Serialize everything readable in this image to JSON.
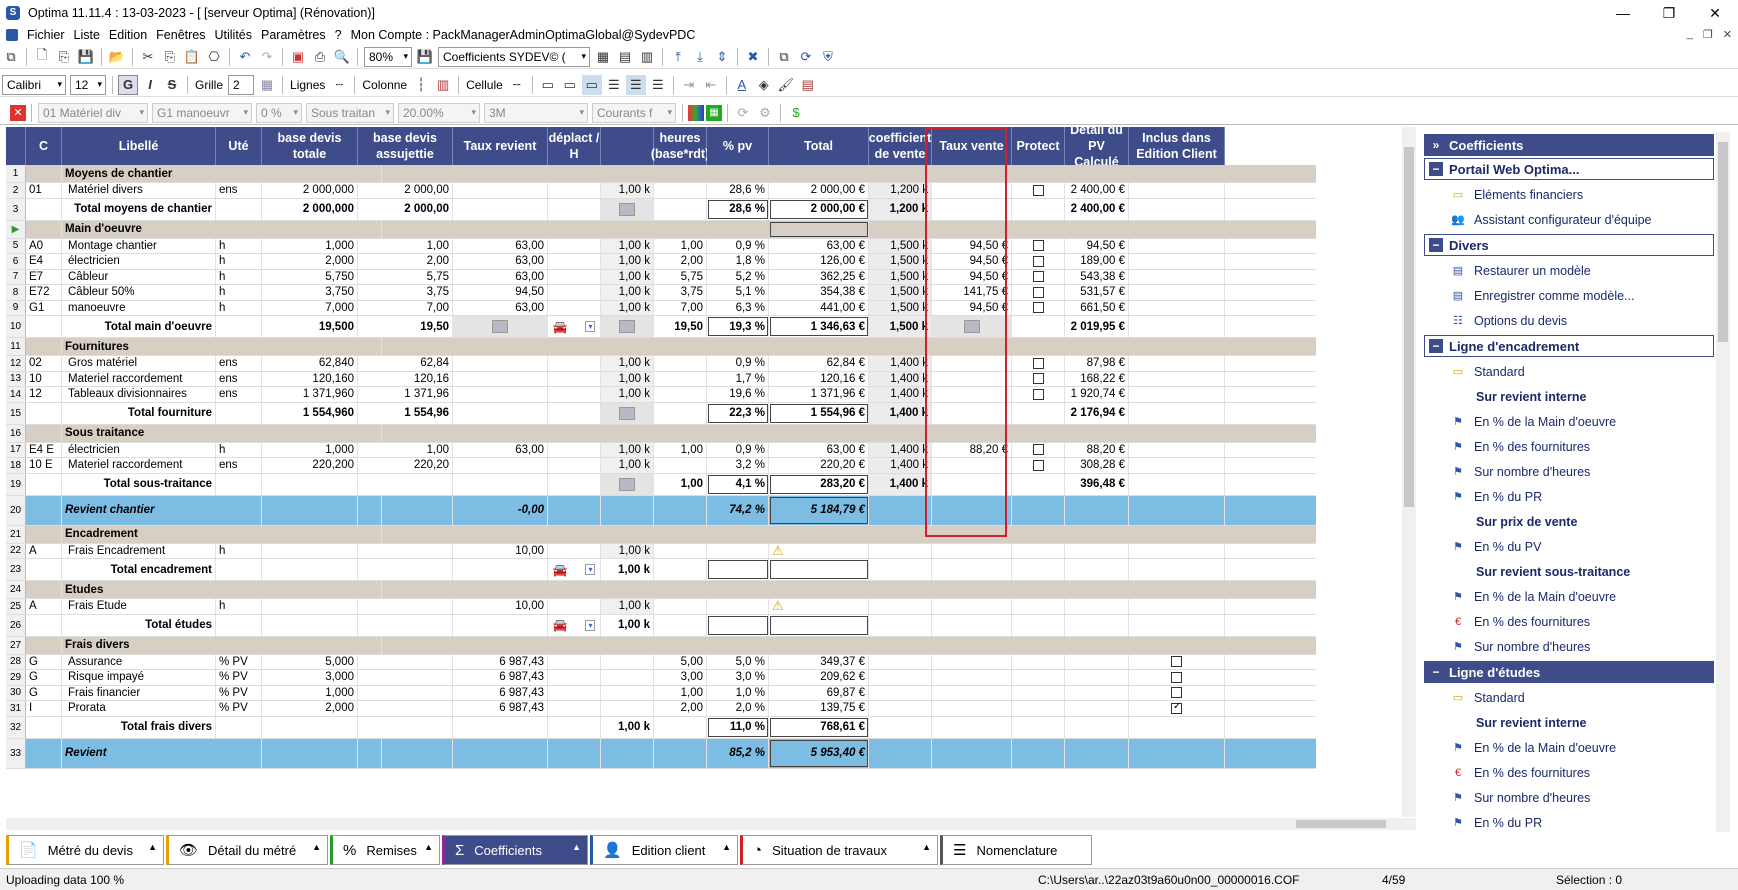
{
  "window": {
    "title": "Optima 11.11.4 : 13-03-2023 - [ [serveur Optima] (Rénovation)]"
  },
  "menu": [
    "Fichier",
    "Liste",
    "Edition",
    "Fenêtres",
    "Utilités",
    "Paramètres",
    "?",
    "Mon Compte : PackManagerAdminOptimaGlobal@SydevPDC"
  ],
  "toolbar1": {
    "zoom": "80%",
    "view": "Coefficients  SYDEV© ("
  },
  "toolbar2": {
    "font": "Calibri",
    "size": "12",
    "bold": "G",
    "italic": "I",
    "strike": "S",
    "grille": "Grille",
    "grille_val": "2",
    "lignes": "Lignes",
    "colonne": "Colonne",
    "cellule": "Cellule"
  },
  "toolbar3": {
    "f1": "01  Matériel div",
    "f2": "G1  manoeuvr",
    "f3": "0 %",
    "f4": "Sous traitan",
    "f5": "20.00%",
    "f6": "3M",
    "f7": "Courants f"
  },
  "headers": [
    "C",
    "Libellé",
    "Uté",
    "base devis totale",
    "base devis assujettie",
    "Taux revient",
    "déplact / H",
    "",
    "heures (base*rdt)",
    "% pv",
    "Total",
    "coefficient de vente",
    "Taux vente",
    "Protect",
    "Détail du PV Calculé",
    "Inclus dans Edition Client"
  ],
  "rows": [
    {
      "n": "1",
      "t": "sec",
      "lib": "Moyens de chantier"
    },
    {
      "n": "2",
      "c": "01",
      "lib": "Matériel divers",
      "ute": "ens",
      "bdt": "2 000,000",
      "bda": "2 000,00",
      "k": "1,00 k",
      "ppv": "28,6 %",
      "tot": "2 000,00 €",
      "coef": "1,200 k",
      "prot": "chk",
      "pv": "2 400,00 €"
    },
    {
      "n": "3",
      "t": "tot",
      "lib": "Total moyens de chantier",
      "bdt": "2 000,000",
      "bda": "2 000,00",
      "kicon": "1",
      "ppv": "28,6 %",
      "tot": "2 000,00 €",
      "coef": "1,200 k",
      "pv": "2 400,00 €"
    },
    {
      "n": "4",
      "t": "sec",
      "lib": "Main d'oeuvre",
      "cur": "1"
    },
    {
      "n": "5",
      "c": "A0",
      "lib": "Montage chantier",
      "ute": "h",
      "bdt": "1,000",
      "bda": "1,00",
      "tr": "63,00",
      "k": "1,00 k",
      "h": "1,00",
      "ppv": "0,9 %",
      "tot": "63,00 €",
      "coef": "1,500 k",
      "tv": "94,50 €",
      "prot": "chk",
      "pv": "94,50 €"
    },
    {
      "n": "6",
      "c": "E4",
      "lib": "électricien",
      "ute": "h",
      "bdt": "2,000",
      "bda": "2,00",
      "tr": "63,00",
      "k": "1,00 k",
      "h": "2,00",
      "ppv": "1,8 %",
      "tot": "126,00 €",
      "coef": "1,500 k",
      "tv": "94,50 €",
      "prot": "chk",
      "pv": "189,00 €"
    },
    {
      "n": "7",
      "c": "E7",
      "lib": "Câbleur",
      "ute": "h",
      "bdt": "5,750",
      "bda": "5,75",
      "tr": "63,00",
      "k": "1,00 k",
      "h": "5,75",
      "ppv": "5,2 %",
      "tot": "362,25 €",
      "coef": "1,500 k",
      "tv": "94,50 €",
      "prot": "chk",
      "pv": "543,38 €"
    },
    {
      "n": "8",
      "c": "E72",
      "lib": "Câbleur 50%",
      "ute": "h",
      "bdt": "3,750",
      "bda": "3,75",
      "tr": "94,50",
      "k": "1,00 k",
      "h": "3,75",
      "ppv": "5,1 %",
      "tot": "354,38 €",
      "coef": "1,500 k",
      "tv": "141,75 €",
      "prot": "chk",
      "pv": "531,57 €"
    },
    {
      "n": "9",
      "c": "G1",
      "lib": "manoeuvre",
      "ute": "h",
      "bdt": "7,000",
      "bda": "7,00",
      "tr": "63,00",
      "k": "1,00 k",
      "h": "7,00",
      "ppv": "6,3 %",
      "tot": "441,00 €",
      "coef": "1,500 k",
      "tv": "94,50 €",
      "prot": "chk",
      "pv": "661,50 €"
    },
    {
      "n": "10",
      "t": "tot",
      "lib": "Total main d'oeuvre",
      "bdt": "19,500",
      "bda": "19,50",
      "tricon": "1",
      "car": "1",
      "kicon": "1",
      "h": "19,50",
      "ppv": "19,3 %",
      "tot": "1 346,63 €",
      "coef": "1,500 k",
      "tvicon": "1",
      "pv": "2 019,95 €"
    },
    {
      "n": "11",
      "t": "sec",
      "lib": "Fournitures"
    },
    {
      "n": "12",
      "c": "02",
      "lib": "Gros matériel",
      "ute": "ens",
      "bdt": "62,840",
      "bda": "62,84",
      "k": "1,00 k",
      "ppv": "0,9 %",
      "tot": "62,84 €",
      "coef": "1,400 k",
      "prot": "chk",
      "pv": "87,98 €"
    },
    {
      "n": "13",
      "c": "10",
      "lib": "Materiel raccordement",
      "ute": "ens",
      "bdt": "120,160",
      "bda": "120,16",
      "k": "1,00 k",
      "ppv": "1,7 %",
      "tot": "120,16 €",
      "coef": "1,400 k",
      "prot": "chk",
      "pv": "168,22 €"
    },
    {
      "n": "14",
      "c": "12",
      "lib": "Tableaux divisionnaires",
      "ute": "ens",
      "bdt": "1 371,960",
      "bda": "1 371,96",
      "k": "1,00 k",
      "ppv": "19,6 %",
      "tot": "1 371,96 €",
      "coef": "1,400 k",
      "prot": "chk",
      "pv": "1 920,74 €"
    },
    {
      "n": "15",
      "t": "tot",
      "lib": "Total fourniture",
      "bdt": "1 554,960",
      "bda": "1 554,96",
      "kicon": "1",
      "ppv": "22,3 %",
      "tot": "1 554,96 €",
      "coef": "1,400 k",
      "pv": "2 176,94 €"
    },
    {
      "n": "16",
      "t": "sec",
      "lib": "Sous traitance"
    },
    {
      "n": "17",
      "c": "E4 E",
      "lib": "électricien",
      "ute": "h",
      "bdt": "1,000",
      "bda": "1,00",
      "tr": "63,00",
      "k": "1,00 k",
      "h": "1,00",
      "ppv": "0,9 %",
      "tot": "63,00 €",
      "coef": "1,400 k",
      "tv": "88,20 €",
      "prot": "chk",
      "pv": "88,20 €"
    },
    {
      "n": "18",
      "c": "10 E",
      "lib": "Materiel raccordement",
      "ute": "ens",
      "bdt": "220,200",
      "bda": "220,20",
      "k": "1,00 k",
      "ppv": "3,2 %",
      "tot": "220,20 €",
      "coef": "1,400 k",
      "prot": "chk",
      "pv": "308,28 €"
    },
    {
      "n": "19",
      "t": "tot",
      "lib": "Total sous-traitance",
      "kicon": "1",
      "h": "1,00",
      "ppv": "4,1 %",
      "tot": "283,20 €",
      "coef": "1,400 k",
      "pv": "396,48 €"
    },
    {
      "n": "20",
      "t": "blue",
      "lib": "Revient chantier",
      "tr": "-0,00",
      "ppv": "74,2 %",
      "tot": "5 184,79 €"
    },
    {
      "n": "21",
      "t": "sec",
      "lib": "Encadrement"
    },
    {
      "n": "22",
      "c": "A",
      "lib": "Frais Encadrement",
      "ute": "h",
      "tr": "10,00",
      "k": "1,00 k",
      "warn": "1"
    },
    {
      "n": "23",
      "t": "tot",
      "lib": "Total encadrement",
      "car": "1",
      "kb": "1,00 k",
      "empty": "1"
    },
    {
      "n": "24",
      "t": "sec",
      "lib": "Etudes"
    },
    {
      "n": "25",
      "c": "A",
      "lib": "Frais Etude",
      "ute": "h",
      "tr": "10,00",
      "k": "1,00 k",
      "warn": "1"
    },
    {
      "n": "26",
      "t": "tot",
      "lib": "Total études",
      "car": "1",
      "kb": "1,00 k",
      "empty": "1"
    },
    {
      "n": "27",
      "t": "sec",
      "lib": "Frais divers"
    },
    {
      "n": "28",
      "c": "G",
      "lib": "Assurance",
      "ute": "% PV",
      "bdt": "5,000",
      "tr": "6 987,43",
      "h": "5,00",
      "ppv": "5,0 %",
      "tot": "349,37 €",
      "inc": "chk"
    },
    {
      "n": "29",
      "c": "G",
      "lib": "Risque impayé",
      "ute": "% PV",
      "bdt": "3,000",
      "tr": "6 987,43",
      "h": "3,00",
      "ppv": "3,0 %",
      "tot": "209,62 €",
      "inc": "chk"
    },
    {
      "n": "30",
      "c": "G",
      "lib": "Frais financier",
      "ute": "% PV",
      "bdt": "1,000",
      "tr": "6 987,43",
      "h": "1,00",
      "ppv": "1,0 %",
      "tot": "69,87 €",
      "inc": "chk"
    },
    {
      "n": "31",
      "c": "I",
      "lib": "Prorata",
      "ute": "% PV",
      "bdt": "2,000",
      "tr": "6 987,43",
      "h": "2,00",
      "ppv": "2,0 %",
      "tot": "139,75 €",
      "inc": "chkon"
    },
    {
      "n": "32",
      "t": "tot",
      "lib": "Total frais divers",
      "kb": "1,00 k",
      "ppv": "11,0 %",
      "tot": "768,61 €"
    },
    {
      "n": "33",
      "t": "blue",
      "lib": "Revient",
      "ppv": "85,2 %",
      "tot": "5 953,40 €"
    }
  ],
  "panel": {
    "title": "Coefficients",
    "groups": [
      {
        "label": "Portail Web Optima...",
        "items": [
          {
            "t": "Eléments financiers",
            "ic": "▭"
          },
          {
            "t": "Assistant configurateur d'équipe",
            "ic": "👥"
          }
        ]
      },
      {
        "label": "Divers",
        "items": [
          {
            "t": "Restaurer un modèle",
            "ic": "▤"
          },
          {
            "t": "Enregistrer comme modèle...",
            "ic": "▤"
          },
          {
            "t": "Options du devis",
            "ic": "☷"
          }
        ]
      },
      {
        "label": "Ligne d'encadrement",
        "items": [
          {
            "t": "Standard",
            "ic": "▭"
          },
          {
            "t": "Sur revient interne",
            "sub": "1"
          },
          {
            "t": "En % de la Main d'oeuvre",
            "ic": "⚑"
          },
          {
            "t": "En % des fournitures",
            "ic": "⚑"
          },
          {
            "t": "Sur nombre d'heures",
            "ic": "⚑"
          },
          {
            "t": "En % du PR",
            "ic": "⚑"
          },
          {
            "t": "Sur prix de vente",
            "sub": "1"
          },
          {
            "t": "En % du PV",
            "ic": "⚑"
          },
          {
            "t": "Sur revient sous-traitance",
            "sub": "1"
          },
          {
            "t": "En % de la Main d'oeuvre",
            "ic": "⚑"
          },
          {
            "t": "En % des fournitures",
            "ic": "€"
          },
          {
            "t": "Sur nombre d'heures",
            "ic": "⚑"
          }
        ]
      },
      {
        "label": "Ligne d'études",
        "dark": "1",
        "items": [
          {
            "t": "Standard",
            "ic": "▭"
          },
          {
            "t": "Sur revient interne",
            "sub": "1"
          },
          {
            "t": "En % de la Main d'oeuvre",
            "ic": "⚑"
          },
          {
            "t": "En % des fournitures",
            "ic": "€"
          },
          {
            "t": "Sur nombre d'heures",
            "ic": "⚑"
          },
          {
            "t": "En % du PR",
            "ic": "⚑"
          }
        ]
      }
    ]
  },
  "tabs": [
    {
      "label": "Métré du devis",
      "ic": "📄"
    },
    {
      "label": "Détail du métré",
      "ic": "👁"
    },
    {
      "label": "Remises",
      "ic": "%"
    },
    {
      "label": "Coefficients",
      "ic": "Σ",
      "active": "1"
    },
    {
      "label": "Edition client",
      "ic": "👤"
    },
    {
      "label": "Situation de travaux",
      "ic": "◔"
    },
    {
      "label": "Nomenclature",
      "ic": "☰"
    }
  ],
  "status": {
    "left": "Uploading data 100 %",
    "file": "C:\\Users\\ar..\\22az03t9a60u0n00_00000016.COF",
    "page": "4/59",
    "sel": "Sélection : 0"
  }
}
